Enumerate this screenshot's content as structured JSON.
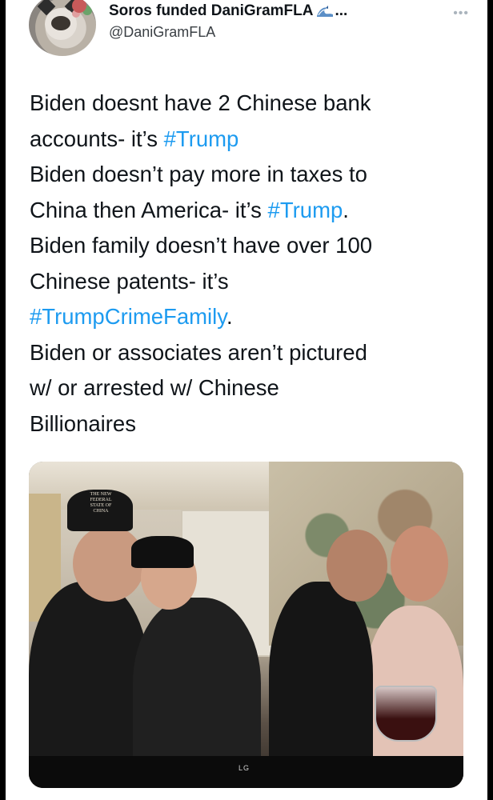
{
  "author": {
    "display_name": "Soros funded DaniGramFLA",
    "name_suffix": "...",
    "handle": "@DaniGramFLA",
    "more_icon": "more-horizontal-icon",
    "badge_icon": "wave-emoji-icon"
  },
  "tweet": {
    "lines": [
      [
        {
          "t": "Biden doesnt have 2 Chinese bank",
          "tag": false
        }
      ],
      [
        {
          "t": "accounts- it’s ",
          "tag": false
        },
        {
          "t": "#Trump",
          "tag": true
        }
      ],
      [
        {
          "t": "Biden doesn’t pay more in taxes to",
          "tag": false
        }
      ],
      [
        {
          "t": "China then America- it’s ",
          "tag": false
        },
        {
          "t": "#Trump",
          "tag": true
        },
        {
          "t": ".",
          "tag": false
        }
      ],
      [
        {
          "t": "Biden family doesn’t have over 100",
          "tag": false
        }
      ],
      [
        {
          "t": "Chinese patents- it’s",
          "tag": false
        }
      ],
      [
        {
          "t": "#TrumpCrimeFamily",
          "tag": true
        },
        {
          "t": ".",
          "tag": false
        }
      ],
      [
        {
          "t": "Biden or associates aren’t pictured",
          "tag": false
        }
      ],
      [
        {
          "t": "w/ or arrested w/ Chinese",
          "tag": false
        }
      ],
      [
        {
          "t": "Billionaires",
          "tag": false
        }
      ]
    ]
  },
  "media": {
    "hat_text": "THE NEW FEDERAL STATE OF CHINA",
    "tv_brand": "LG"
  },
  "colors": {
    "hashtag": "#1d9bf0",
    "text": "#0f1419",
    "secondary": "#3a3f44"
  }
}
